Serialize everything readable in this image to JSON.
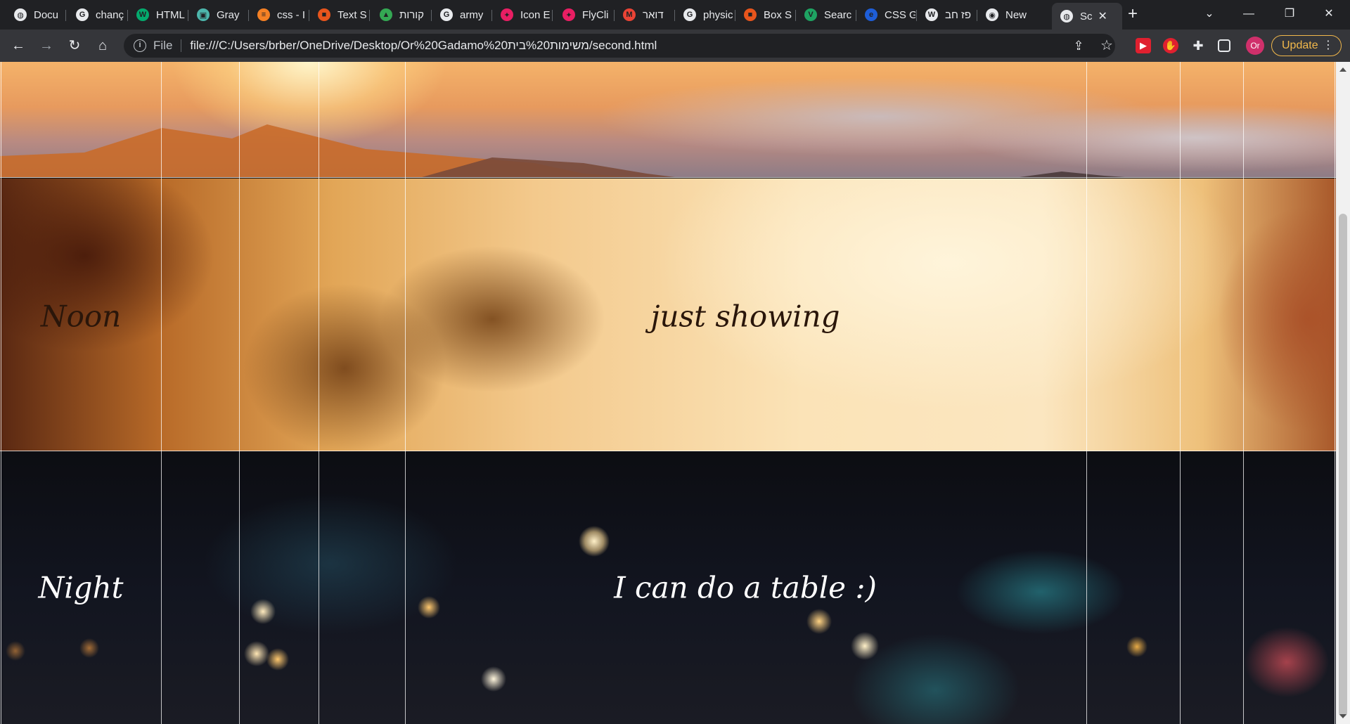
{
  "browser": {
    "tabs": [
      {
        "label": "Docu",
        "icon": "globe-icon",
        "color": "#e8eaed"
      },
      {
        "label": "chanç",
        "icon": "google-icon",
        "color": "#e8eaed"
      },
      {
        "label": "HTML",
        "icon": "w3schools-icon",
        "color": "#04aa6d"
      },
      {
        "label": "Gray",
        "icon": "doc-icon",
        "color": "#4db6ac"
      },
      {
        "label": "css - I",
        "icon": "stackoverflow-icon",
        "color": "#f48024"
      },
      {
        "label": "Text S",
        "icon": "office-icon",
        "color": "#e8551c"
      },
      {
        "label": "קורות",
        "icon": "drive-icon",
        "color": "#34a853"
      },
      {
        "label": "army",
        "icon": "google-icon",
        "color": "#e8eaed"
      },
      {
        "label": "Icon E",
        "icon": "bird-icon",
        "color": "#e91e63"
      },
      {
        "label": "FlyCli",
        "icon": "bird-icon",
        "color": "#e91e63"
      },
      {
        "label": "דואר",
        "icon": "gmail-icon",
        "color": "#ea4335"
      },
      {
        "label": "physic",
        "icon": "google-icon",
        "color": "#e8eaed"
      },
      {
        "label": "Box S",
        "icon": "office-icon",
        "color": "#e8551c"
      },
      {
        "label": "Searc",
        "icon": "vuetify-icon",
        "color": "#1ea362"
      },
      {
        "label": "CSS G",
        "icon": "edge-icon",
        "color": "#1e5ed8"
      },
      {
        "label": "פז חב",
        "icon": "wikipedia-icon",
        "color": "#e8eaed"
      },
      {
        "label": "New",
        "icon": "chrome-icon",
        "color": "#e8eaed"
      },
      {
        "label": "Sc",
        "icon": "globe-icon",
        "color": "#e8eaed"
      }
    ],
    "new_tab_symbol": "+",
    "window_controls": {
      "tab_search": "⌄",
      "minimize": "—",
      "restore": "❐",
      "close": "✕"
    },
    "toolbar": {
      "back": "←",
      "forward": "→",
      "reload": "↻",
      "home": "⌂",
      "scheme_label": "File",
      "url": "file:///C:/Users/brber/OneDrive/Desktop/Or%20Gadamo%20משימות%20בית/second.html",
      "share": "⇪",
      "bookmark": "☆",
      "profile_initials": "Or",
      "update_label": "Update",
      "menu": "⋮"
    }
  },
  "page": {
    "rows": [
      {
        "label": "",
        "content": "",
        "theme": "sunset"
      },
      {
        "label": "Noon",
        "content": "just showing",
        "theme": "noon"
      },
      {
        "label": "Night",
        "content": "I can do a table :)",
        "theme": "night"
      }
    ]
  }
}
